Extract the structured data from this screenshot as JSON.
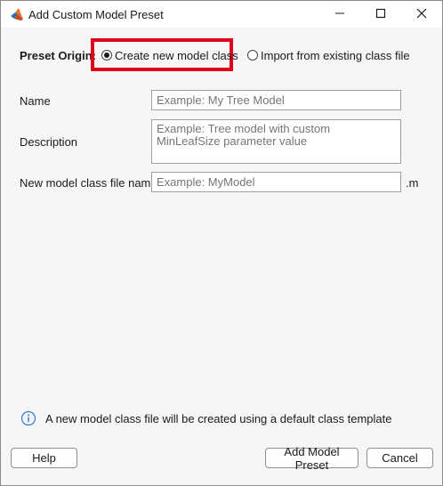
{
  "window": {
    "title": "Add Custom Model Preset",
    "icons": {
      "app": "matlab-logo-icon",
      "minimize": "minimize-icon",
      "maximize": "maximize-icon",
      "close": "close-icon"
    }
  },
  "preset_origin": {
    "label": "Preset Origin:",
    "options": [
      {
        "label": "Create new model class",
        "selected": true
      },
      {
        "label": "Import from existing class file",
        "selected": false
      }
    ],
    "highlight_color": "#e0001b"
  },
  "fields": {
    "name": {
      "label": "Name",
      "value": "",
      "placeholder": "Example: My Tree Model"
    },
    "description": {
      "label": "Description",
      "value": "",
      "placeholder": "Example: Tree model with custom MinLeafSize parameter value"
    },
    "file_name": {
      "label": "New model class file name",
      "value": "",
      "placeholder": "Example: MyModel",
      "extension": ".m"
    }
  },
  "info": {
    "icon": "info-icon",
    "text": "A new model class file will be created using a default class template"
  },
  "buttons": {
    "help": "Help",
    "add": "Add Model Preset",
    "cancel": "Cancel"
  }
}
